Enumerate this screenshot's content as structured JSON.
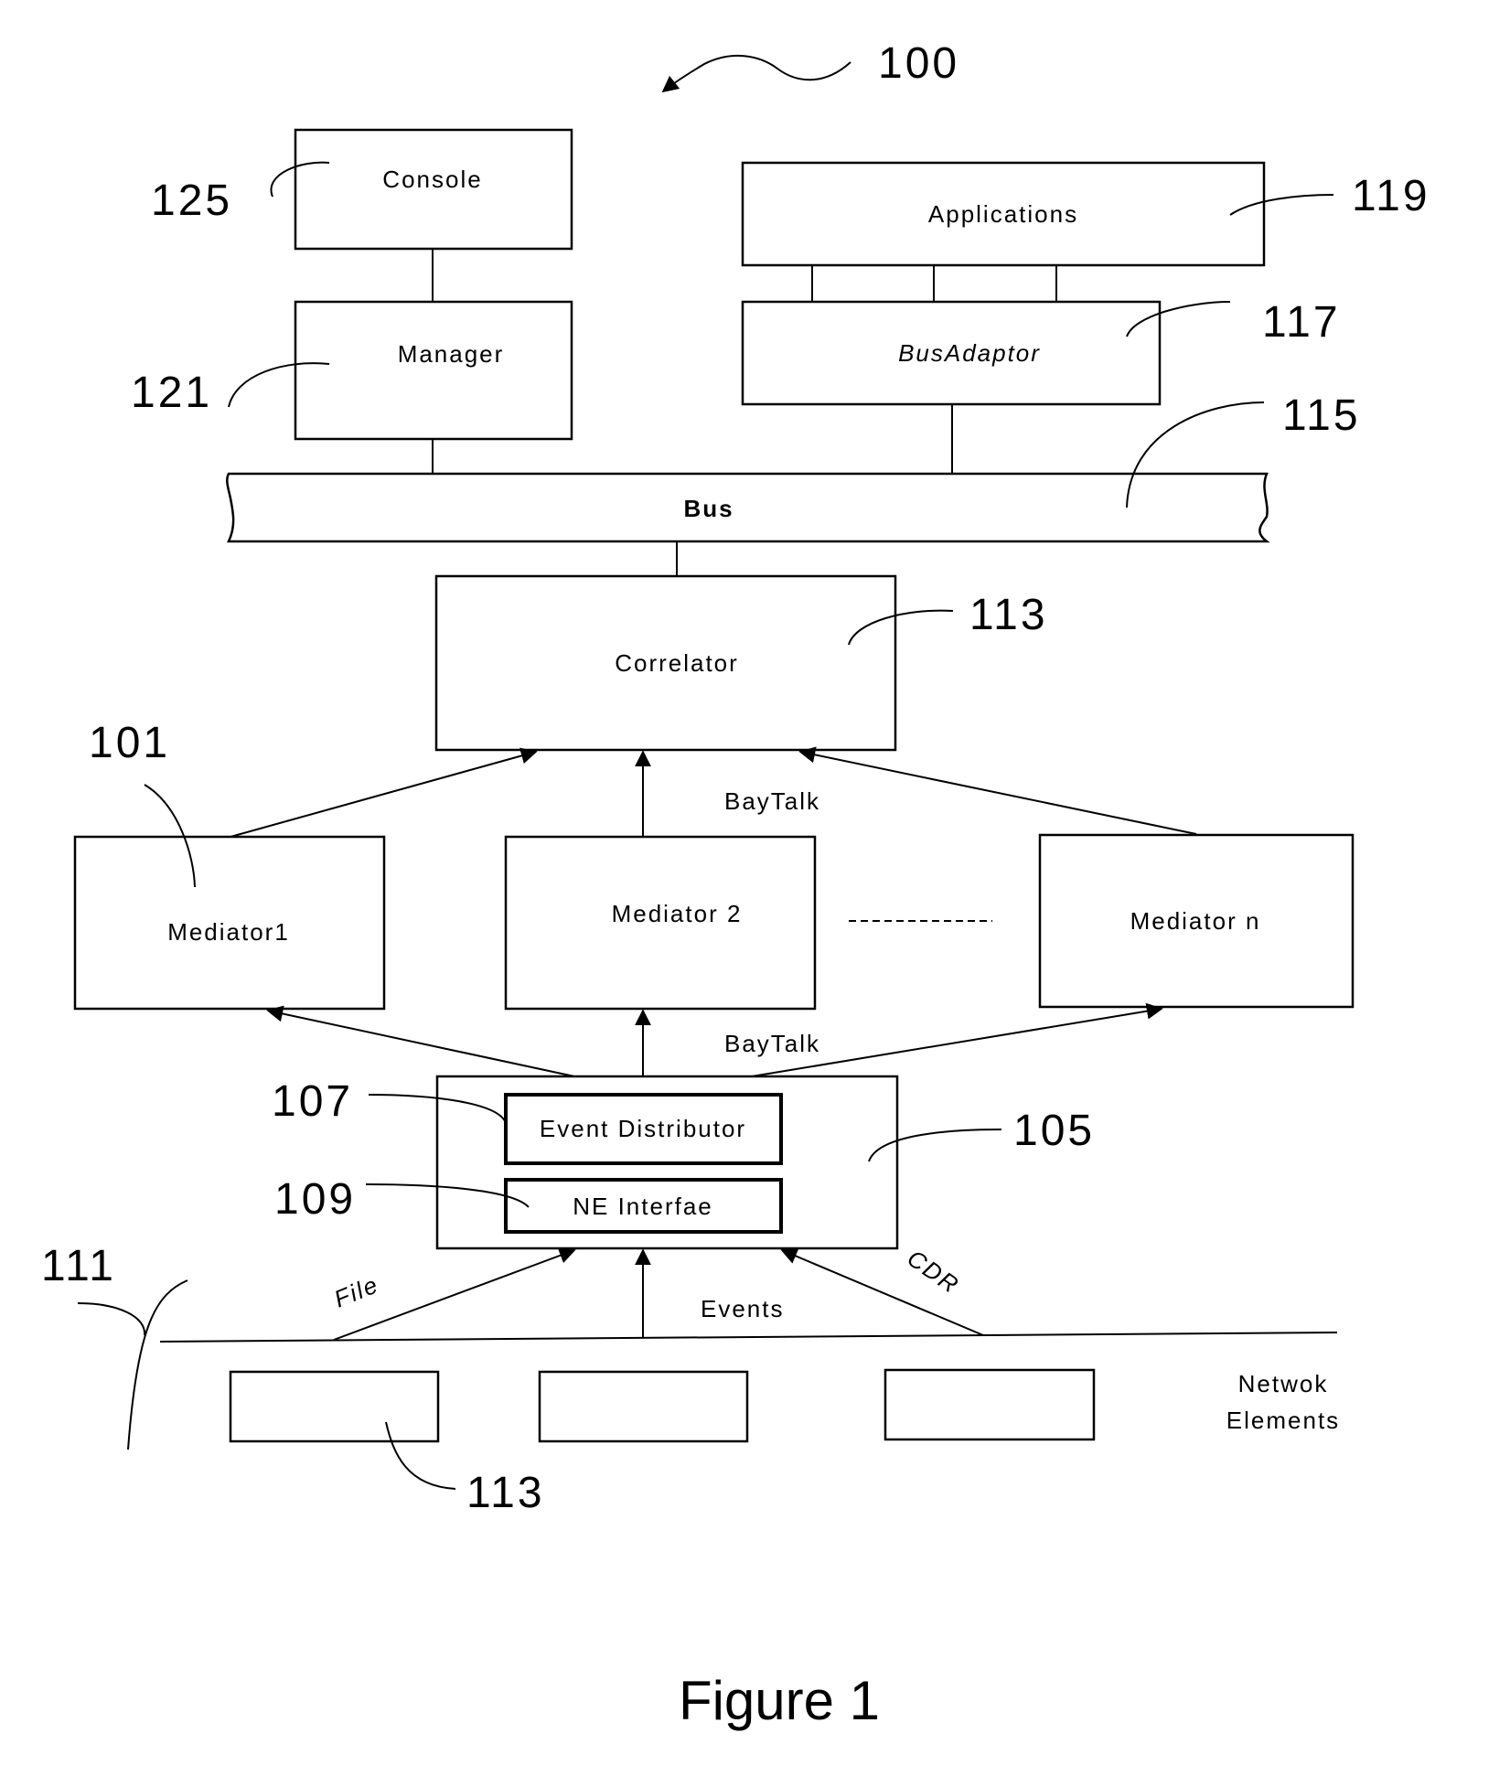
{
  "figure": {
    "caption": "Figure 1",
    "reference": "100"
  },
  "components": {
    "console": {
      "label": "Console",
      "ref": "125"
    },
    "manager": {
      "label": "Manager",
      "ref": "121"
    },
    "applications": {
      "label": "Applications",
      "ref": "119"
    },
    "bus_adaptor": {
      "label": "BusAdaptor",
      "ref": "117"
    },
    "bus": {
      "label": "Bus",
      "ref": "115"
    },
    "correlator": {
      "label": "Correlator",
      "ref": "113"
    },
    "mediator1": {
      "label": "Mediator1",
      "ref": "101"
    },
    "mediator2": {
      "label": "Mediator 2"
    },
    "mediator_n": {
      "label": "Mediator n"
    },
    "event_distributor": {
      "label": "Event Distributor",
      "ref": "107"
    },
    "ne_interface": {
      "label": "NE Interfae",
      "ref": "109"
    },
    "collector": {
      "ref": "105"
    },
    "network_line": {
      "ref": "111"
    },
    "network_elements": {
      "label_line1": "Netwok",
      "label_line2": "Elements",
      "ref": "113"
    }
  },
  "connections": {
    "baytalk_upper": "BayTalk",
    "baytalk_lower": "BayTalk",
    "file": "File",
    "events": "Events",
    "cdr": "CDR"
  }
}
